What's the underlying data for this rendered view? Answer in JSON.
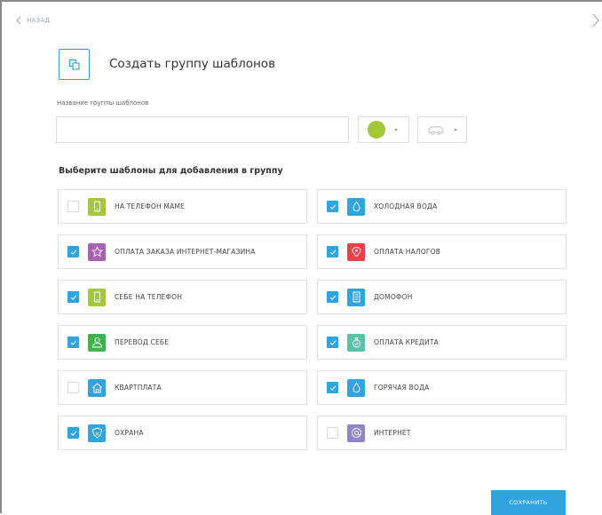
{
  "nav": {
    "back_label": "НАЗАД"
  },
  "page": {
    "title": "Создать группу шаблонов",
    "name_label": "Название группы шаблонов",
    "name_value": "",
    "selected_color": "#a3c93a",
    "section_title": "Выберите шаблоны для добавления в группу",
    "save_label": "СОХРАНИТЬ"
  },
  "templates": [
    {
      "label": "НА ТЕЛЕФОН МАМЕ",
      "checked": false,
      "icon": "phone-icon",
      "color": "#a3c93a"
    },
    {
      "label": "ХОЛОДНАЯ ВОДА",
      "checked": true,
      "icon": "drop-icon",
      "color": "#2fa4df"
    },
    {
      "label": "ОПЛАТА ЗАКАЗА ИНТЕРНЕТ-МАГАЗИНА",
      "checked": true,
      "icon": "star-icon",
      "color": "#a95fb4"
    },
    {
      "label": "ОПЛАТА  НАЛОГОВ",
      "checked": true,
      "icon": "emblem-icon",
      "color": "#e8414a"
    },
    {
      "label": "СЕБЕ НА ТЕЛЕФОН",
      "checked": true,
      "icon": "phone-icon",
      "color": "#a3c93a"
    },
    {
      "label": "ДОМОФОН",
      "checked": true,
      "icon": "intercom-icon",
      "color": "#2fa4df"
    },
    {
      "label": "ПЕРЕВОД СЕБЕ",
      "checked": true,
      "icon": "person-icon",
      "color": "#3cb54a"
    },
    {
      "label": "ОПЛАТА КРЕДИТА",
      "checked": true,
      "icon": "moneybag-icon",
      "color": "#57c2a7"
    },
    {
      "label": "КВАРТПЛАТА",
      "checked": false,
      "icon": "house-icon",
      "color": "#2fa4df"
    },
    {
      "label": "ГОРЯЧАЯ ВОДА",
      "checked": true,
      "icon": "drop-icon",
      "color": "#2fa4df"
    },
    {
      "label": "ОХРАНА",
      "checked": true,
      "icon": "shield-icon",
      "color": "#2fa4df"
    },
    {
      "label": "ИНТЕРНЕТ",
      "checked": false,
      "icon": "at-icon",
      "color": "#8e86c6"
    }
  ]
}
